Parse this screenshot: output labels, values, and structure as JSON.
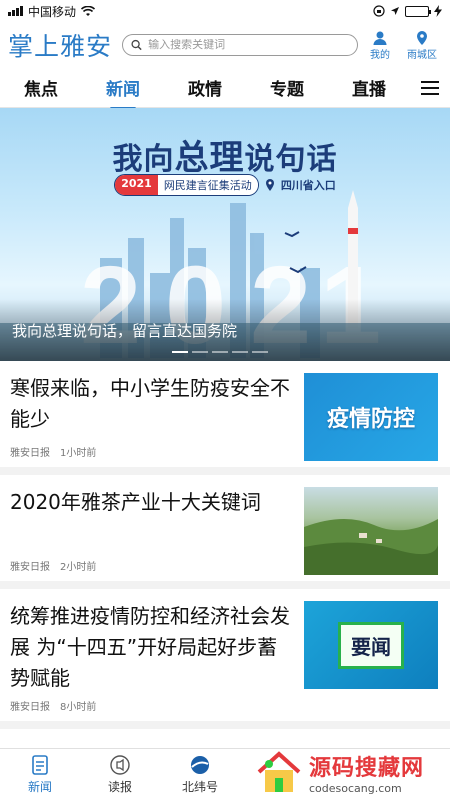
{
  "status_bar": {
    "carrier": "中国移动",
    "time": ""
  },
  "header": {
    "logo": "掌上雅安",
    "search_placeholder": "输入搜索关键词",
    "my_label": "我的",
    "region_label": "雨城区"
  },
  "nav": {
    "tabs": [
      {
        "label": "焦点"
      },
      {
        "label": "新闻",
        "active": true
      },
      {
        "label": "政情"
      },
      {
        "label": "专题"
      },
      {
        "label": "直播"
      }
    ]
  },
  "banner": {
    "title_part1": "我向",
    "title_accent": "总理",
    "title_part2": "说句话",
    "year": "2021",
    "campaign": "网民建言征集活动",
    "entry": "四川省入口",
    "caption": "我向总理说句话，留言直达国务院",
    "slide_count": 5,
    "active_slide": 1
  },
  "news": [
    {
      "title": "寒假来临，中小学生防疫安全不能少",
      "source": "雅安日报",
      "time": "1小时前",
      "thumb_text": "疫情防控"
    },
    {
      "title": "2020年雅茶产业十大关键词",
      "source": "雅安日报",
      "time": "2小时前",
      "thumb_text": ""
    },
    {
      "title": "统筹推进疫情防控和经济社会发展 为“十四五”开好局起好步蓄势赋能",
      "source": "雅安日报",
      "time": "8小时前",
      "thumb_text": "要闻"
    }
  ],
  "tab_bar": {
    "items": [
      {
        "label": "新闻",
        "icon": "news-icon",
        "active": true
      },
      {
        "label": "读报",
        "icon": "newspaper-icon"
      },
      {
        "label": "北纬号",
        "icon": "globe-icon"
      }
    ]
  },
  "watermark": {
    "main": "源码搜藏网",
    "sub": "codesocang.com"
  },
  "colors": {
    "brand": "#2a7bc6",
    "accent_red": "#e4393c"
  }
}
